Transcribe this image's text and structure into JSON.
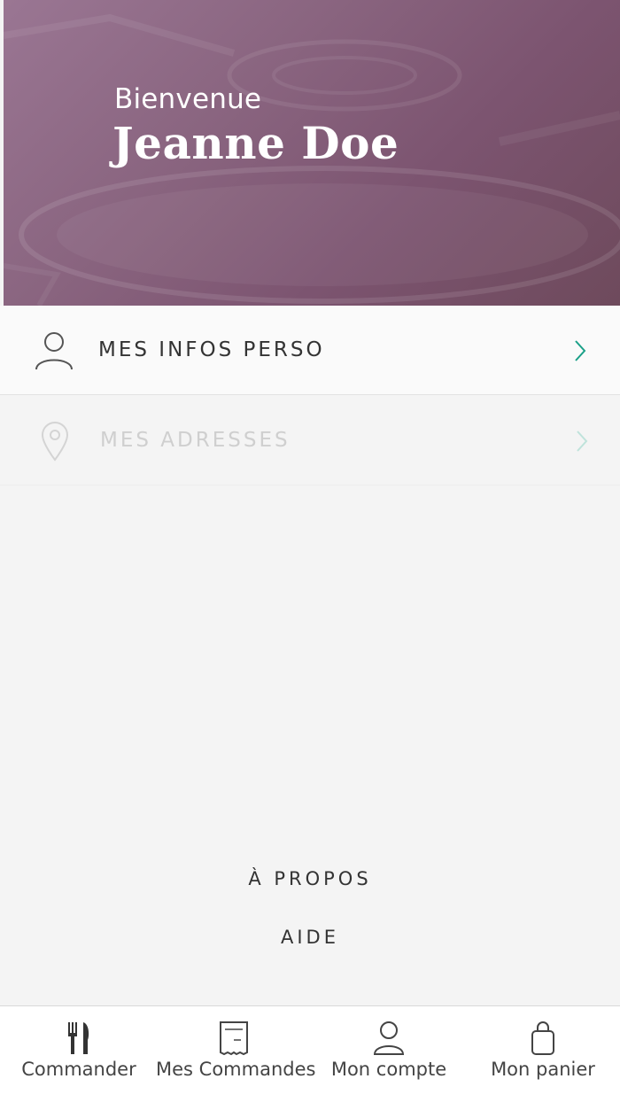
{
  "header": {
    "welcome": "Bienvenue",
    "username": "Jeanne Doe"
  },
  "menu": {
    "items": [
      {
        "label": "MES INFOS PERSO",
        "icon": "user-icon",
        "enabled": true
      },
      {
        "label": "MES ADRESSES",
        "icon": "location-pin-icon",
        "enabled": false
      }
    ]
  },
  "links": {
    "apropos": "À PROPOS",
    "aide": "AIDE"
  },
  "tabbar": {
    "tabs": [
      {
        "label": "Commander",
        "icon": "fork-knife-icon"
      },
      {
        "label": "Mes Commandes",
        "icon": "receipt-icon"
      },
      {
        "label": "Mon compte",
        "icon": "user-icon"
      },
      {
        "label": "Mon panier",
        "icon": "shopping-bag-icon"
      }
    ]
  },
  "colors": {
    "accent": "#1aa088",
    "header_tint": "#8a6580",
    "background": "#f4f4f4"
  }
}
